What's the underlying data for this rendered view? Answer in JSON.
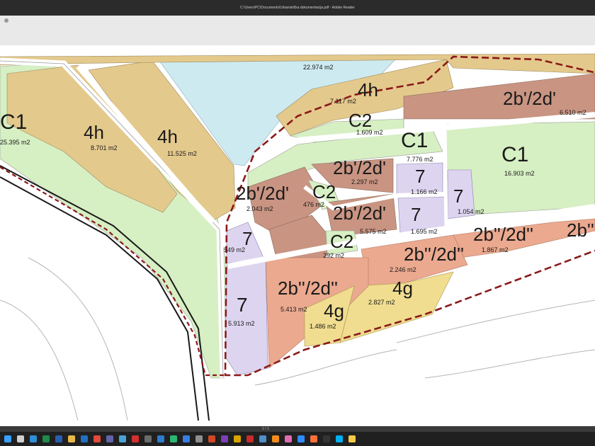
{
  "window": {
    "title": "C:\\Users\\PC\\Documents\\Urbanistička dokumentacija.pdf - Adobe Reader"
  },
  "status": {
    "page_info": "1 / 1"
  },
  "map": {
    "zones": {
      "c1_left": {
        "label": "C1",
        "area": "25.395 m2"
      },
      "4h_a": {
        "label": "4h",
        "area": "8.701 m2"
      },
      "4h_b": {
        "label": "4h",
        "area": "11.525 m2"
      },
      "4h_top": {
        "label": "4h",
        "area": "7.117 m2"
      },
      "sport": {
        "area": "22.974 m2"
      },
      "2bd_top": {
        "label": "2b'/2d'",
        "area": "6.510 m2"
      },
      "c2_top": {
        "label": "C2",
        "area": "1.609 m2"
      },
      "c1_mid": {
        "label": "C1",
        "area": "7.776 m2"
      },
      "c1_right": {
        "label": "C1",
        "area": "16.903 m2"
      },
      "2bd_a": {
        "label": "2b'/2d'",
        "area": "2.297 m2"
      },
      "2bd_b": {
        "label": "2b'/2d'",
        "area": "2.043 m2"
      },
      "c2_mid": {
        "label": "C2",
        "area": "476 m2"
      },
      "7_a": {
        "label": "7",
        "area": "1.166 m2"
      },
      "7_b": {
        "label": "7",
        "area": "1.054 m2"
      },
      "2bd_c": {
        "label": "2b'/2d'",
        "area": "5.575 m2"
      },
      "7_c": {
        "label": "7",
        "area": "1.695 m2"
      },
      "7_d": {
        "label": "7",
        "area": "549 m2"
      },
      "c2_low": {
        "label": "C2",
        "area": "292 m2"
      },
      "2bdd_a": {
        "label": "2b''/2d''",
        "area": "1.867 m2"
      },
      "2bdd_edge": {
        "label": "2b''"
      },
      "2bdd_b": {
        "label": "2b''/2d''",
        "area": "2.246 m2"
      },
      "4g_a": {
        "label": "4g",
        "area": "2.827 m2"
      },
      "2bdd_c": {
        "label": "2b''/2d''",
        "area": "5.413 m2"
      },
      "4g_b": {
        "label": "4g",
        "area": "1.486 m2"
      },
      "7_e": {
        "label": "7",
        "area": "5.913 m2"
      }
    },
    "colors": {
      "green": "#d6efc3",
      "tan": "#e4c98c",
      "brown": "#c99482",
      "lavender": "#ddd5f0",
      "salmon": "#eba98f",
      "yellow": "#f0dd8f",
      "cyan": "#cdeaf0",
      "boundary": "#8a1a1a"
    }
  },
  "taskbar": {
    "icons": [
      {
        "name": "start-icon",
        "color": "#3aa0ff"
      },
      {
        "name": "search-icon",
        "color": "#cfcfcf"
      },
      {
        "name": "edge-icon",
        "color": "#2f8ed8"
      },
      {
        "name": "excel-icon",
        "color": "#1f8a4c"
      },
      {
        "name": "word-icon",
        "color": "#2a5db0"
      },
      {
        "name": "folder-icon",
        "color": "#e6b84a"
      },
      {
        "name": "outlook-icon",
        "color": "#1f70c1"
      },
      {
        "name": "chrome-icon",
        "color": "#e24a3b"
      },
      {
        "name": "teams-icon",
        "color": "#6264a7"
      },
      {
        "name": "photos-icon",
        "color": "#48a3d6"
      },
      {
        "name": "acrobat-icon",
        "color": "#d3302f"
      },
      {
        "name": "calc-icon",
        "color": "#6b6b6b"
      },
      {
        "name": "mail-icon",
        "color": "#2e7bcf"
      },
      {
        "name": "maps-icon",
        "color": "#2bb673"
      },
      {
        "name": "store-icon",
        "color": "#3a7de0"
      },
      {
        "name": "settings-icon",
        "color": "#8f8f8f"
      },
      {
        "name": "powerpoint-icon",
        "color": "#d24726"
      },
      {
        "name": "onenote-icon",
        "color": "#7b3fb3"
      },
      {
        "name": "viewer-icon",
        "color": "#d9a400"
      },
      {
        "name": "autocad-icon",
        "color": "#c72c2c"
      },
      {
        "name": "notepad-icon",
        "color": "#4e8fc7"
      },
      {
        "name": "vlc-icon",
        "color": "#f28c1b"
      },
      {
        "name": "paint-icon",
        "color": "#e06bb1"
      },
      {
        "name": "zoom-icon",
        "color": "#2d8cff"
      },
      {
        "name": "firefox-icon",
        "color": "#ff7139"
      },
      {
        "name": "terminal-icon",
        "color": "#333333"
      },
      {
        "name": "skype-icon",
        "color": "#00aff0"
      },
      {
        "name": "notes-icon",
        "color": "#f7c948"
      }
    ]
  }
}
